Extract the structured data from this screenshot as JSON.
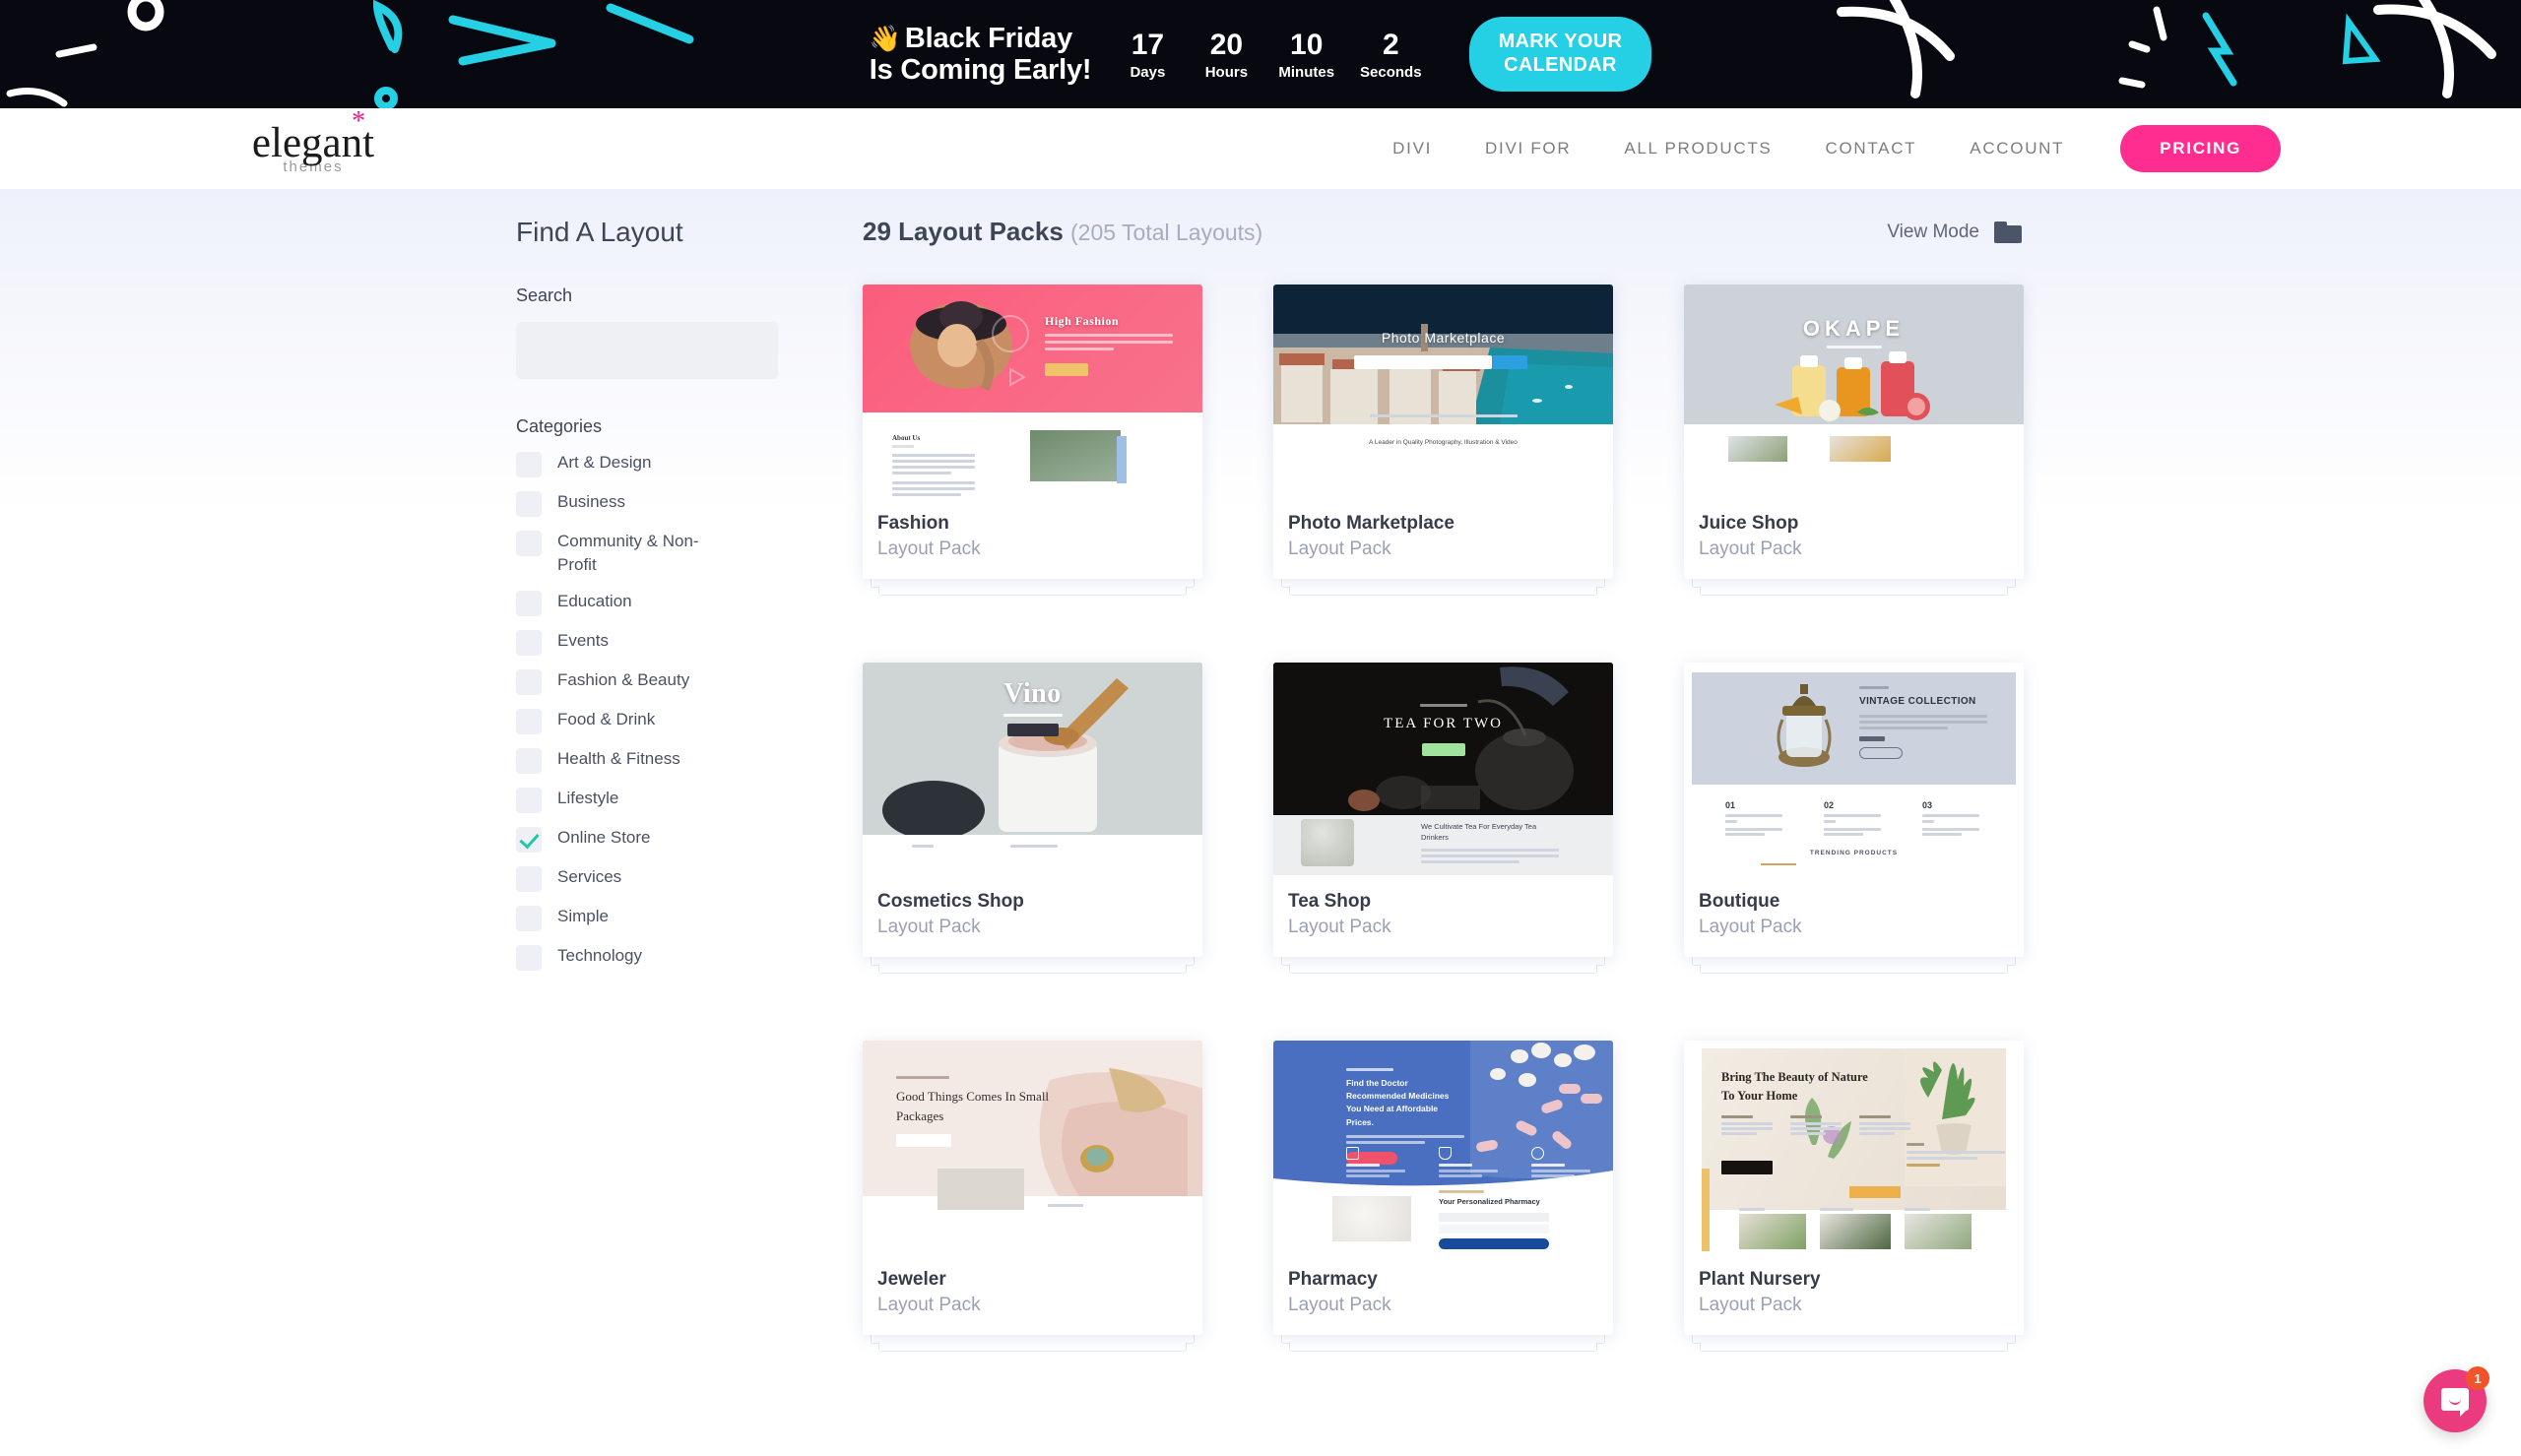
{
  "promo": {
    "headline_line1": "Black Friday",
    "headline_line2": "Is Coming Early!",
    "wave_icon": "👋",
    "countdown": [
      {
        "value": "17",
        "label": "Days"
      },
      {
        "value": "20",
        "label": "Hours"
      },
      {
        "value": "10",
        "label": "Minutes"
      },
      {
        "value": "2",
        "label": "Seconds"
      }
    ],
    "cta_label": "MARK YOUR\nCALENDAR",
    "cta_color": "#25cfe4",
    "background": "#080810"
  },
  "header": {
    "logo_main": "elegant",
    "logo_star": "*",
    "logo_sub": "themes",
    "nav": [
      {
        "label": "DIVI"
      },
      {
        "label": "DIVI FOR"
      },
      {
        "label": "ALL PRODUCTS"
      },
      {
        "label": "CONTACT"
      },
      {
        "label": "ACCOUNT"
      }
    ],
    "pricing_label": "PRICING",
    "pricing_color": "#ff2d8f"
  },
  "sidebar": {
    "title": "Find A Layout",
    "search_label": "Search",
    "search_value": "",
    "search_placeholder": "",
    "categories_label": "Categories",
    "categories": [
      {
        "label": "Art & Design",
        "checked": false
      },
      {
        "label": "Business",
        "checked": false
      },
      {
        "label": "Community & Non-Profit",
        "checked": false
      },
      {
        "label": "Education",
        "checked": false
      },
      {
        "label": "Events",
        "checked": false
      },
      {
        "label": "Fashion & Beauty",
        "checked": false
      },
      {
        "label": "Food & Drink",
        "checked": false
      },
      {
        "label": "Health & Fitness",
        "checked": false
      },
      {
        "label": "Lifestyle",
        "checked": false
      },
      {
        "label": "Online Store",
        "checked": true
      },
      {
        "label": "Services",
        "checked": false
      },
      {
        "label": "Simple",
        "checked": false
      },
      {
        "label": "Technology",
        "checked": false
      }
    ],
    "check_color": "#22c8a9"
  },
  "results": {
    "pack_count": "29 Layout Packs",
    "total_layouts": "(205 Total Layouts)",
    "view_mode_label": "View Mode",
    "view_mode_icon": "folder-icon",
    "cards": [
      {
        "title": "Fashion",
        "subtitle": "Layout Pack",
        "preview": {
          "style": "fashion",
          "hero_text": "High Fashion",
          "section_text": "About Us"
        }
      },
      {
        "title": "Photo Marketplace",
        "subtitle": "Layout Pack",
        "preview": {
          "style": "photo",
          "hero_text": "Photo Marketplace",
          "section_text": "A Leader in Quality Photography, Illustration & Video"
        }
      },
      {
        "title": "Juice Shop",
        "subtitle": "Layout Pack",
        "preview": {
          "style": "juice",
          "hero_text": "OKAPE",
          "section_text": ""
        }
      },
      {
        "title": "Cosmetics Shop",
        "subtitle": "Layout Pack",
        "preview": {
          "style": "cosmetics",
          "hero_text": "Vino",
          "section_text": ""
        }
      },
      {
        "title": "Tea Shop",
        "subtitle": "Layout Pack",
        "preview": {
          "style": "tea",
          "hero_text": "TEA FOR TWO",
          "section_text": "We Cultivate Tea For Everyday Tea Drinkers"
        }
      },
      {
        "title": "Boutique",
        "subtitle": "Layout Pack",
        "preview": {
          "style": "boutique",
          "hero_text": "VINTAGE COLLECTION",
          "section_text": "TRENDING PRODUCTS",
          "steps": [
            "01",
            "02",
            "03"
          ]
        }
      },
      {
        "title": "Jeweler",
        "subtitle": "Layout Pack",
        "preview": {
          "style": "jeweler",
          "hero_text": "Good Things Comes In Small Packages",
          "section_text": ""
        }
      },
      {
        "title": "Pharmacy",
        "subtitle": "Layout Pack",
        "preview": {
          "style": "pharmacy",
          "hero_text": "Find the Doctor Recommended Medicines You Need at Affordable Prices.",
          "section_text": "Your Personalized Pharmacy"
        }
      },
      {
        "title": "Plant Nursery",
        "subtitle": "Layout Pack",
        "preview": {
          "style": "plant",
          "hero_text": "Bring The Beauty of Nature To Your Home",
          "section_text": ""
        }
      }
    ]
  },
  "chat_widget": {
    "badge_count": "1",
    "color": "#eb3a7e",
    "badge_color": "#f2542a"
  }
}
